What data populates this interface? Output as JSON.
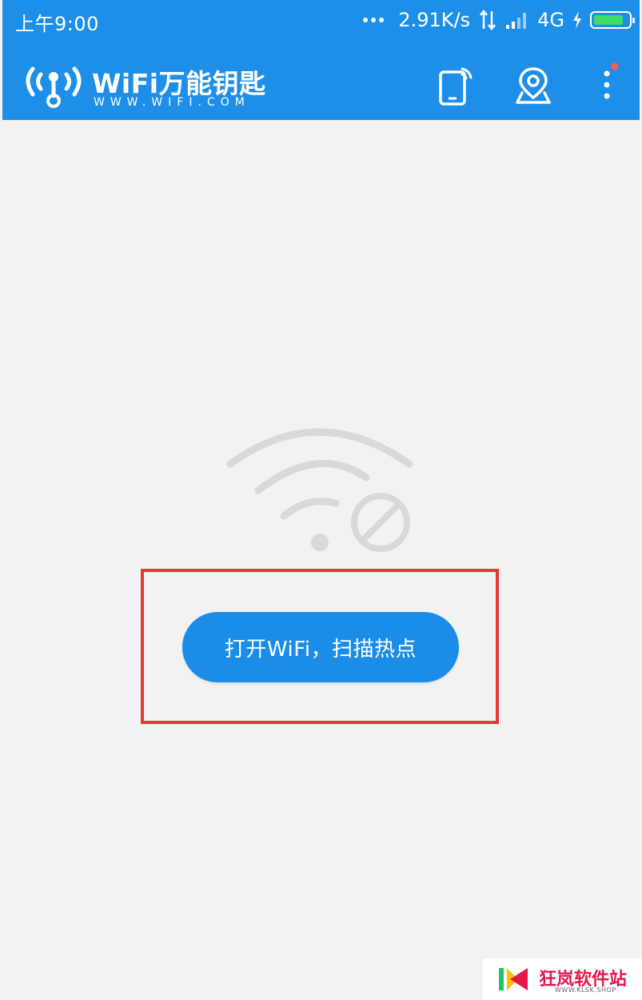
{
  "status_bar": {
    "time": "上午9:00",
    "speed": "2.91K/s",
    "network": "4G",
    "battery_fraction": 0.85
  },
  "app_bar": {
    "brand_name": "WiFi万能钥匙",
    "brand_url": "WWW.WIFI.COM"
  },
  "main": {
    "open_wifi_button": "打开WiFi，扫描热点"
  },
  "watermark": {
    "title": "狂岚软件站",
    "subtitle": "WWW.KLSK.SHOP"
  },
  "colors": {
    "brand_blue": "#1e8fe9",
    "button_blue": "#1b8ce8",
    "highlight_red": "#e53935",
    "notification_dot": "#ff5a4e",
    "background": "#f2f2f2"
  },
  "icons": {
    "app_logo": "wifi-key-icon",
    "phone_signal": "phone-wifi-icon",
    "location": "location-pin-icon",
    "more": "more-vertical-icon",
    "status_wifi_off": "wifi-disabled-icon"
  }
}
